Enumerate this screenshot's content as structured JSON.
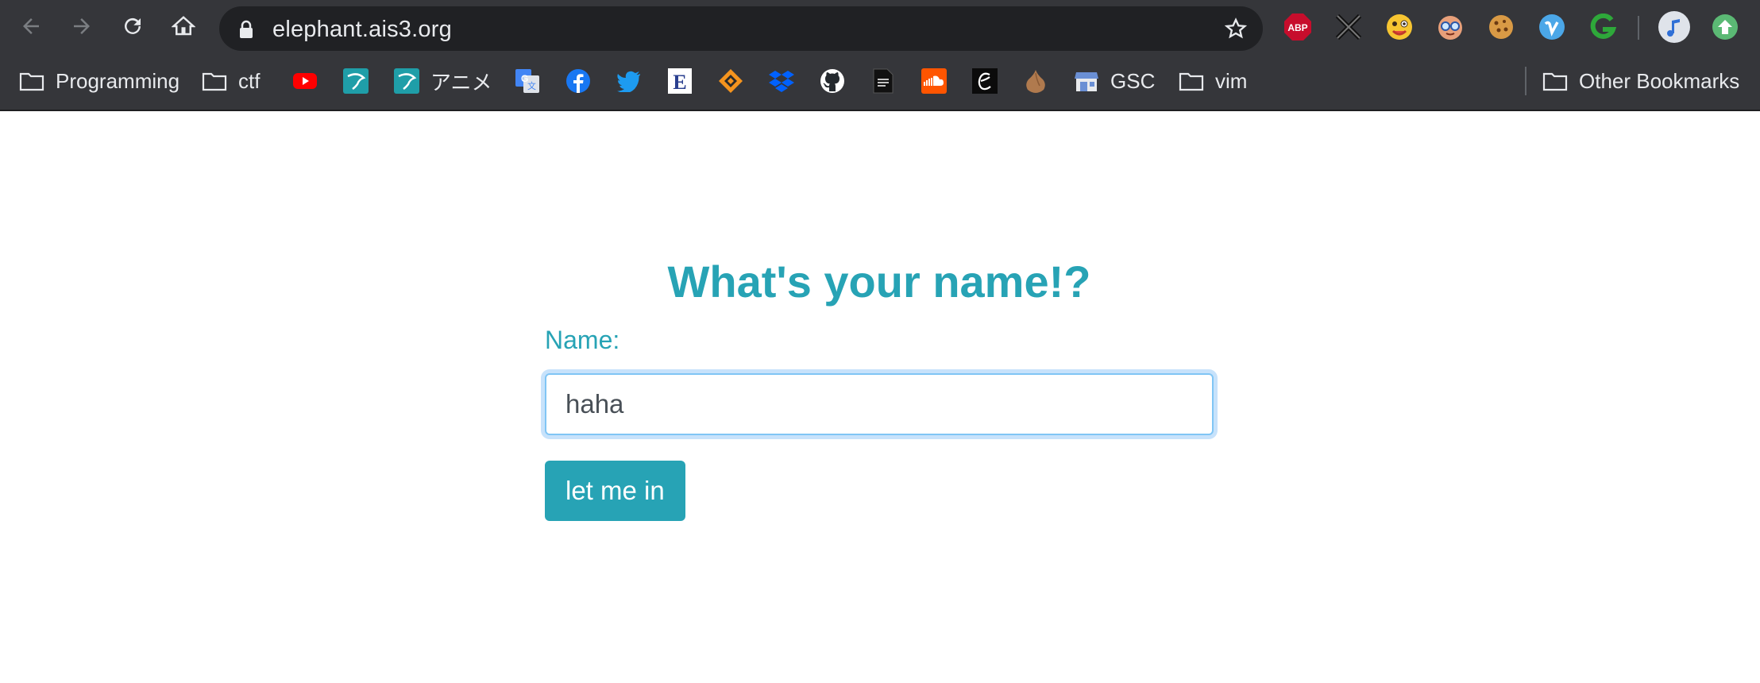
{
  "browser": {
    "url": "elephant.ais3.org",
    "bookmarks": [
      {
        "label": "Programming",
        "icon": "folder-icon"
      },
      {
        "label": "ctf",
        "icon": "folder-icon"
      },
      {
        "label": "",
        "icon": "youtube-icon"
      },
      {
        "label": "",
        "icon": "shrimp-icon"
      },
      {
        "label": "アニメ",
        "icon": "shrimp-icon"
      },
      {
        "label": "",
        "icon": "google-translate-icon"
      },
      {
        "label": "",
        "icon": "facebook-icon"
      },
      {
        "label": "",
        "icon": "twitter-icon"
      },
      {
        "label": "",
        "icon": "e-book-icon"
      },
      {
        "label": "",
        "icon": "orange-diamond-icon"
      },
      {
        "label": "",
        "icon": "dropbox-icon"
      },
      {
        "label": "",
        "icon": "github-icon"
      },
      {
        "label": "",
        "icon": "document-icon"
      },
      {
        "label": "",
        "icon": "soundcloud-icon"
      },
      {
        "label": "",
        "icon": "script-e-icon"
      },
      {
        "label": "",
        "icon": "onion-icon"
      },
      {
        "label": "GSC",
        "icon": "store-icon"
      },
      {
        "label": "vim",
        "icon": "folder-icon"
      }
    ],
    "other_bookmarks": "Other Bookmarks",
    "extensions": [
      "abp-icon",
      "x-extension-icon",
      "emoji-icon",
      "nerd-face-icon",
      "cookie-icon",
      "vimeo-icon",
      "g-extension-icon",
      "music-profile-icon",
      "update-arrow-icon"
    ]
  },
  "colors": {
    "accent": "#27a3b5",
    "chrome_bg": "#35363a",
    "omnibox_bg": "#202124"
  },
  "page": {
    "title": "What's your name!?",
    "name_label": "Name:",
    "name_value": "haha",
    "submit_label": "let me in"
  }
}
